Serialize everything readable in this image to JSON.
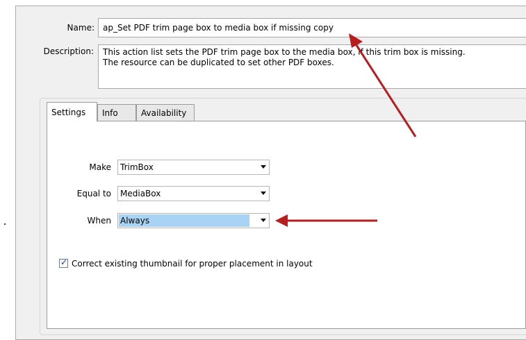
{
  "form": {
    "name_label": "Name:",
    "name_value": "ap_Set PDF trim page box to media box if missing copy",
    "description_label": "Description:",
    "description_lines": [
      "This action list sets the PDF trim page box to the media box, if this trim box is missing.",
      "The resource can be duplicated to set other PDF boxes."
    ]
  },
  "tabs": [
    {
      "label": "Settings",
      "active": true
    },
    {
      "label": "Info",
      "active": false
    },
    {
      "label": "Availability",
      "active": false
    }
  ],
  "settings": {
    "make_label": "Make",
    "make_value": "TrimBox",
    "equal_label": "Equal to",
    "equal_value": "MediaBox",
    "when_label": "When",
    "when_value": "Always",
    "checkbox_label": "Correct existing thumbnail for proper placement in layout",
    "checkbox_checked": true
  },
  "colors": {
    "annotation_arrow": "#b81c1c",
    "selection_highlight": "#a9d3f4"
  }
}
